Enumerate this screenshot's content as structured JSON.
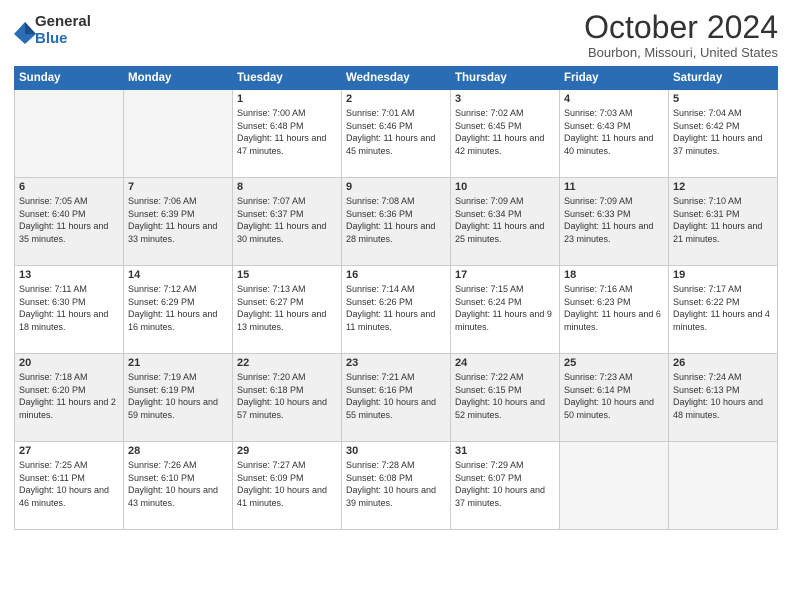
{
  "logo": {
    "general": "General",
    "blue": "Blue"
  },
  "title": "October 2024",
  "location": "Bourbon, Missouri, United States",
  "days_of_week": [
    "Sunday",
    "Monday",
    "Tuesday",
    "Wednesday",
    "Thursday",
    "Friday",
    "Saturday"
  ],
  "weeks": [
    [
      {
        "day": "",
        "info": ""
      },
      {
        "day": "",
        "info": ""
      },
      {
        "day": "1",
        "info": "Sunrise: 7:00 AM\nSunset: 6:48 PM\nDaylight: 11 hours and 47 minutes."
      },
      {
        "day": "2",
        "info": "Sunrise: 7:01 AM\nSunset: 6:46 PM\nDaylight: 11 hours and 45 minutes."
      },
      {
        "day": "3",
        "info": "Sunrise: 7:02 AM\nSunset: 6:45 PM\nDaylight: 11 hours and 42 minutes."
      },
      {
        "day": "4",
        "info": "Sunrise: 7:03 AM\nSunset: 6:43 PM\nDaylight: 11 hours and 40 minutes."
      },
      {
        "day": "5",
        "info": "Sunrise: 7:04 AM\nSunset: 6:42 PM\nDaylight: 11 hours and 37 minutes."
      }
    ],
    [
      {
        "day": "6",
        "info": "Sunrise: 7:05 AM\nSunset: 6:40 PM\nDaylight: 11 hours and 35 minutes."
      },
      {
        "day": "7",
        "info": "Sunrise: 7:06 AM\nSunset: 6:39 PM\nDaylight: 11 hours and 33 minutes."
      },
      {
        "day": "8",
        "info": "Sunrise: 7:07 AM\nSunset: 6:37 PM\nDaylight: 11 hours and 30 minutes."
      },
      {
        "day": "9",
        "info": "Sunrise: 7:08 AM\nSunset: 6:36 PM\nDaylight: 11 hours and 28 minutes."
      },
      {
        "day": "10",
        "info": "Sunrise: 7:09 AM\nSunset: 6:34 PM\nDaylight: 11 hours and 25 minutes."
      },
      {
        "day": "11",
        "info": "Sunrise: 7:09 AM\nSunset: 6:33 PM\nDaylight: 11 hours and 23 minutes."
      },
      {
        "day": "12",
        "info": "Sunrise: 7:10 AM\nSunset: 6:31 PM\nDaylight: 11 hours and 21 minutes."
      }
    ],
    [
      {
        "day": "13",
        "info": "Sunrise: 7:11 AM\nSunset: 6:30 PM\nDaylight: 11 hours and 18 minutes."
      },
      {
        "day": "14",
        "info": "Sunrise: 7:12 AM\nSunset: 6:29 PM\nDaylight: 11 hours and 16 minutes."
      },
      {
        "day": "15",
        "info": "Sunrise: 7:13 AM\nSunset: 6:27 PM\nDaylight: 11 hours and 13 minutes."
      },
      {
        "day": "16",
        "info": "Sunrise: 7:14 AM\nSunset: 6:26 PM\nDaylight: 11 hours and 11 minutes."
      },
      {
        "day": "17",
        "info": "Sunrise: 7:15 AM\nSunset: 6:24 PM\nDaylight: 11 hours and 9 minutes."
      },
      {
        "day": "18",
        "info": "Sunrise: 7:16 AM\nSunset: 6:23 PM\nDaylight: 11 hours and 6 minutes."
      },
      {
        "day": "19",
        "info": "Sunrise: 7:17 AM\nSunset: 6:22 PM\nDaylight: 11 hours and 4 minutes."
      }
    ],
    [
      {
        "day": "20",
        "info": "Sunrise: 7:18 AM\nSunset: 6:20 PM\nDaylight: 11 hours and 2 minutes."
      },
      {
        "day": "21",
        "info": "Sunrise: 7:19 AM\nSunset: 6:19 PM\nDaylight: 10 hours and 59 minutes."
      },
      {
        "day": "22",
        "info": "Sunrise: 7:20 AM\nSunset: 6:18 PM\nDaylight: 10 hours and 57 minutes."
      },
      {
        "day": "23",
        "info": "Sunrise: 7:21 AM\nSunset: 6:16 PM\nDaylight: 10 hours and 55 minutes."
      },
      {
        "day": "24",
        "info": "Sunrise: 7:22 AM\nSunset: 6:15 PM\nDaylight: 10 hours and 52 minutes."
      },
      {
        "day": "25",
        "info": "Sunrise: 7:23 AM\nSunset: 6:14 PM\nDaylight: 10 hours and 50 minutes."
      },
      {
        "day": "26",
        "info": "Sunrise: 7:24 AM\nSunset: 6:13 PM\nDaylight: 10 hours and 48 minutes."
      }
    ],
    [
      {
        "day": "27",
        "info": "Sunrise: 7:25 AM\nSunset: 6:11 PM\nDaylight: 10 hours and 46 minutes."
      },
      {
        "day": "28",
        "info": "Sunrise: 7:26 AM\nSunset: 6:10 PM\nDaylight: 10 hours and 43 minutes."
      },
      {
        "day": "29",
        "info": "Sunrise: 7:27 AM\nSunset: 6:09 PM\nDaylight: 10 hours and 41 minutes."
      },
      {
        "day": "30",
        "info": "Sunrise: 7:28 AM\nSunset: 6:08 PM\nDaylight: 10 hours and 39 minutes."
      },
      {
        "day": "31",
        "info": "Sunrise: 7:29 AM\nSunset: 6:07 PM\nDaylight: 10 hours and 37 minutes."
      },
      {
        "day": "",
        "info": ""
      },
      {
        "day": "",
        "info": ""
      }
    ]
  ]
}
